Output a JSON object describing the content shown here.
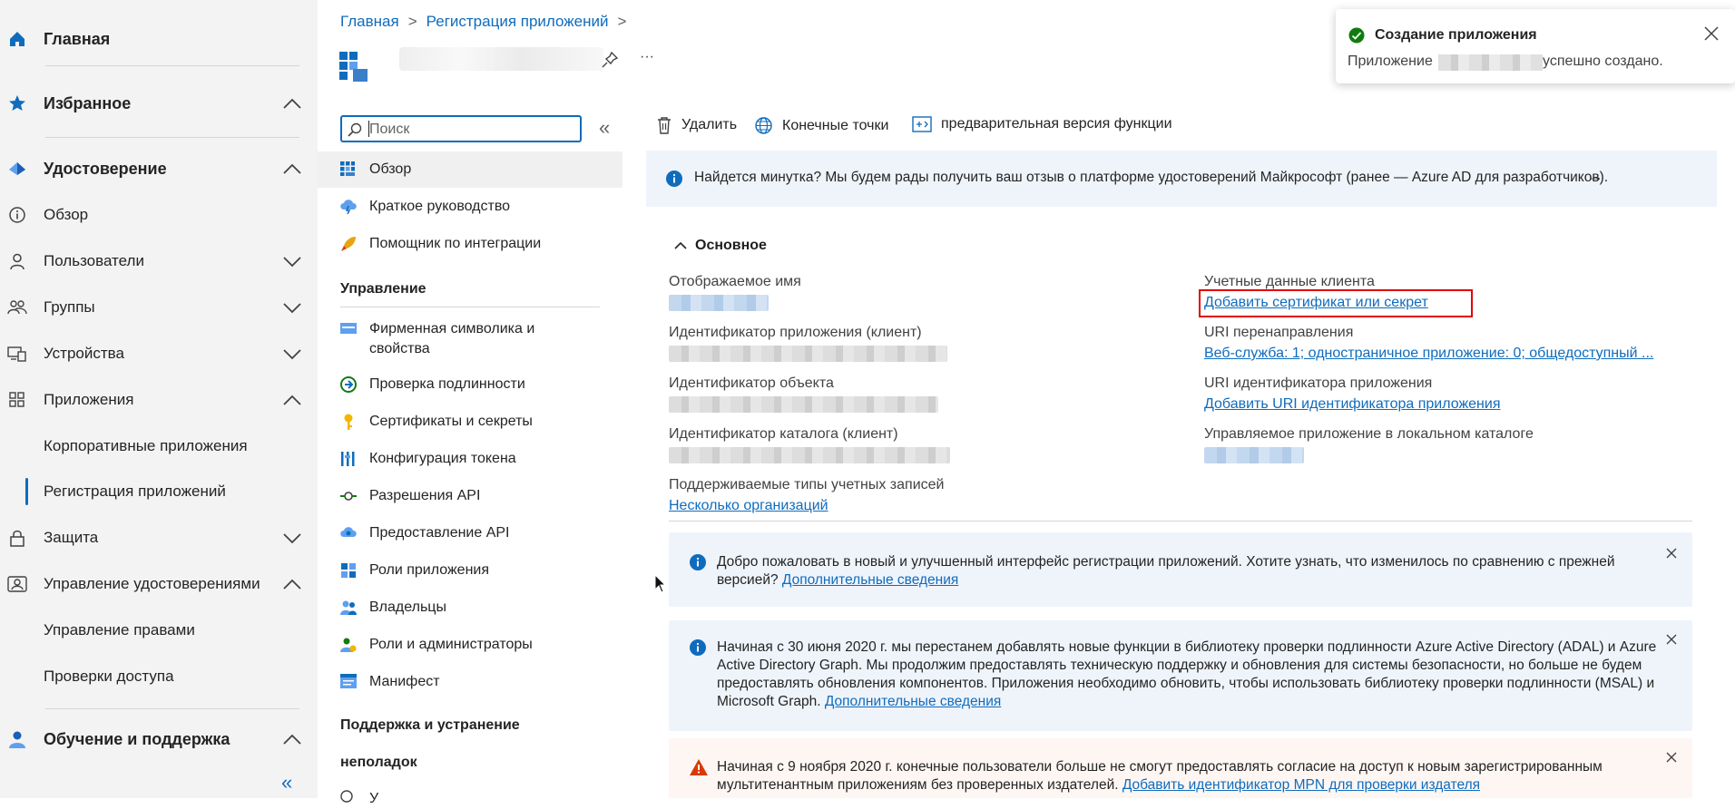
{
  "left_nav": {
    "home": "Главная",
    "favorites": "Избранное",
    "identity": "Удостоверение",
    "overview": "Обзор",
    "users": "Пользователи",
    "groups": "Группы",
    "devices": "Устройства",
    "applications": "Приложения",
    "enterprise_apps": "Корпоративные приложения",
    "app_registrations": "Регистрация приложений",
    "protection": "Защита",
    "identity_governance": "Управление удостоверениями",
    "entitlement_management": "Управление правами",
    "access_reviews": "Проверки доступа",
    "learn_support": "Обучение и поддержка",
    "collapse_glyph": "«"
  },
  "breadcrumb": {
    "home": "Главная",
    "app_registrations": "Регистрация приложений",
    "sep": ">"
  },
  "header": {
    "more": "···"
  },
  "resource_nav": {
    "search_placeholder": "Поиск",
    "collapse_glyph": "«",
    "items_top": [
      "Обзор",
      "Краткое руководство",
      "Помощник по интеграции"
    ],
    "manage_heading": "Управление",
    "manage_items": [
      "Фирменная символика и свойства",
      "Проверка подлинности",
      "Сертификаты и секреты",
      "Конфигурация токена",
      "Разрешения API",
      "Предоставление API",
      "Роли приложения",
      "Владельцы",
      "Роли и администраторы",
      "Манифест"
    ],
    "support_heading_1": "Поддержка и устранение",
    "support_heading_2": "неполадок",
    "partial_item": "У"
  },
  "commands": {
    "delete": "Удалить",
    "endpoints": "Конечные точки",
    "preview": "предварительная версия функции"
  },
  "feedback_banner": {
    "text": "Найдется минутка? Мы будем рады получить ваш отзыв о платформе удостоверений Майкрософт (ранее — Azure AD для разработчиков).",
    "arrow": "→"
  },
  "essentials": {
    "title": "Основное",
    "display_name_label": "Отображаемое имя",
    "app_id_label": "Идентификатор приложения (клиент)",
    "object_id_label": "Идентификатор объекта",
    "tenant_id_label": "Идентификатор каталога (клиент)",
    "account_types_label": "Поддерживаемые типы учетных записей",
    "account_types_value": "Несколько организаций",
    "client_creds_label": "Учетные данные клиента",
    "client_creds_value": "Добавить сертификат или секрет",
    "redirect_label": "URI перенаправления",
    "redirect_value": "Веб-служба: 1; одностраничное приложение: 0; общедоступный ...",
    "app_id_uri_label": "URI идентификатора приложения",
    "app_id_uri_value": "Добавить URI идентификатора приложения",
    "managed_app_label": "Управляемое приложение в локальном каталоге"
  },
  "banners": {
    "welcome_text": "Добро пожаловать в новый и улучшенный интерфейс регистрации приложений. Хотите узнать, что изменилось по сравнению с прежней версией?",
    "welcome_link": "Дополнительные сведения",
    "adal_text": "Начиная с 30 июня 2020 г. мы перестанем добавлять новые функции в библиотеку проверки подлинности Azure Active Directory (ADAL) и Azure Active Directory Graph. Мы продолжим предоставлять техническую поддержку и обновления для системы безопасности, но больше не будем предоставлять обновления компонентов. Приложения необходимо обновить, чтобы использовать библиотеку проверки подлинности (MSAL) и Microsoft Graph.",
    "adal_link": "Дополнительные сведения",
    "consent_text": "Начиная с 9 ноября 2020 г. конечные пользователи больше не смогут предоставлять согласие на доступ к новым зарегистрированным мультитенантным приложениям без проверенных издателей.",
    "consent_link": "Добавить идентификатор MPN для проверки издателя"
  },
  "toast": {
    "title": "Создание приложения",
    "text_prefix": "Приложение",
    "text_suffix": "успешно создано."
  },
  "colors": {
    "accent": "#0f6cbd",
    "success": "#107c10",
    "warning": "#d83b01",
    "highlight": "#e00000",
    "info_bg": "#eff4fb",
    "warn_bg": "#fdf6f3"
  }
}
